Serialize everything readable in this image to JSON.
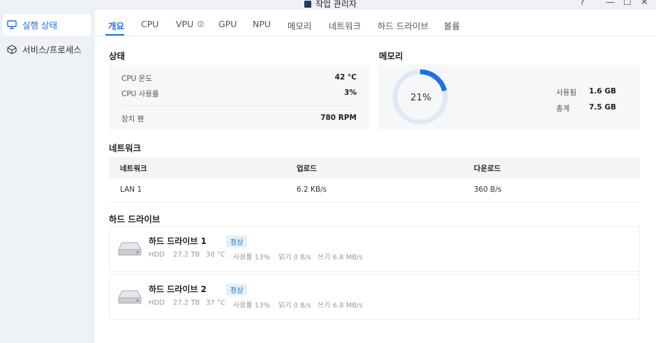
{
  "window": {
    "title": "작업 관리자",
    "controls": {
      "help": "?",
      "minimize": "—",
      "maximize": "☐",
      "close": "✕"
    }
  },
  "sidebar": {
    "items": [
      {
        "label": "실행 상태",
        "icon": "monitor-icon",
        "active": true
      },
      {
        "label": "서비스/프로세스",
        "icon": "cube-icon",
        "active": false
      }
    ]
  },
  "tabs": [
    {
      "label": "개요",
      "active": true
    },
    {
      "label": "CPU"
    },
    {
      "label": "VPU",
      "info_icon": "info-icon"
    },
    {
      "label": "GPU"
    },
    {
      "label": "NPU"
    },
    {
      "label": "메모리"
    },
    {
      "label": "네트워크"
    },
    {
      "label": "하드 드라이브"
    },
    {
      "label": "볼륨"
    }
  ],
  "status": {
    "title": "상태",
    "rows": [
      {
        "label": "CPU 온도",
        "value": "42 °C"
      },
      {
        "label": "CPU 사용률",
        "value": "3%"
      },
      {
        "label": "장치 팬",
        "value": "780 RPM"
      }
    ]
  },
  "memory": {
    "title": "메모리",
    "percent_label": "21%",
    "used_fraction": 0.21,
    "used_label": "사용됨",
    "used_value": "1.6 GB",
    "total_label": "총계",
    "total_value": "7.5 GB",
    "ring_color": "#1d6fe8",
    "ring_bg_color": "#dfe8f7"
  },
  "network": {
    "title": "네트워크",
    "headers": [
      "네트워크",
      "업로드",
      "다운로드"
    ],
    "rows": [
      [
        "LAN 1",
        "6.2 KB/s",
        "360 B/s"
      ]
    ]
  },
  "drives": {
    "title": "하드 드라이브",
    "items": [
      {
        "name": "하드 드라이브 1",
        "status": "정상",
        "type": "HDD",
        "size": "27.2 TB",
        "temp": "38 °C",
        "usage": "사용률 13%",
        "read": "읽기 0 B/s",
        "write": "쓰기 6.8 MB/s"
      },
      {
        "name": "하드 드라이브 2",
        "status": "정상",
        "type": "HDD",
        "size": "27.2 TB",
        "temp": "37 °C",
        "usage": "사용률 13%",
        "read": "읽기 0 B/s",
        "write": "쓰기 6.8 MB/s"
      }
    ]
  },
  "colors": {
    "accent": "#1d6fe8",
    "sidebar_bg": "#eef1f6",
    "card_bg": "#f6f7f9"
  }
}
